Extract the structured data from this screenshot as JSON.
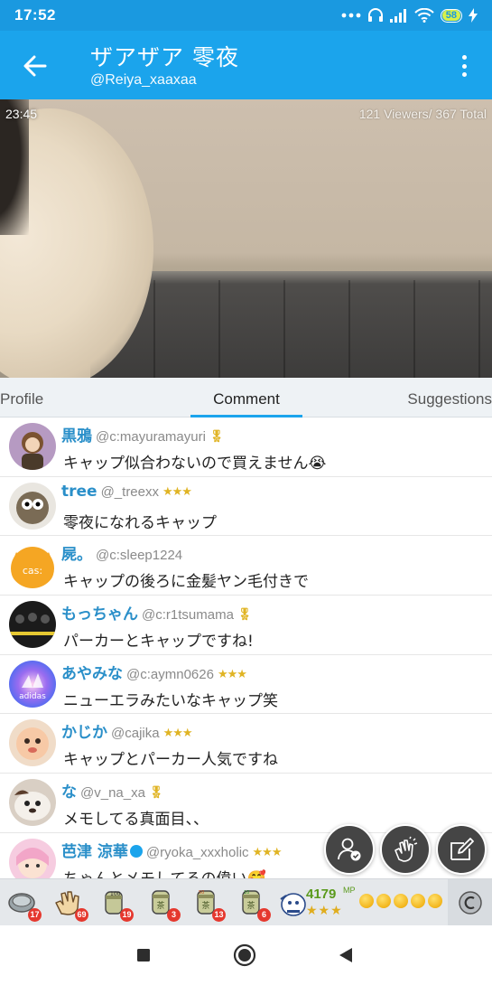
{
  "status_bar": {
    "time": "17:52",
    "battery": "58"
  },
  "header": {
    "title": "ザアザア 零夜",
    "username": "@Reiya_xaaxaa"
  },
  "video": {
    "elapsed": "23:45",
    "viewers_text": "121 Viewers/ 367 Total"
  },
  "tabs": [
    {
      "label": "Profile"
    },
    {
      "label": "Comment",
      "active": true
    },
    {
      "label": "Suggestions"
    }
  ],
  "comments": [
    {
      "name": "黒鴉",
      "handle": "@c:mayuramayuri",
      "badge": "🎖",
      "text": "キャップ似合わないので買えません😭"
    },
    {
      "name": "tree",
      "handle": "@_treexx",
      "badge": "★★★",
      "text": "零夜になれるキャップ"
    },
    {
      "name": "屍。",
      "handle": "@c:sleep1224",
      "badge": "",
      "text": "キャップの後ろに金髪ヤン毛付きで"
    },
    {
      "name": "もっちゃん",
      "handle": "@c:r1tsumama",
      "badge": "🎖",
      "text": "パーカーとキャップですね!"
    },
    {
      "name": "あやみな",
      "handle": "@c:aymn0626",
      "badge": "★★★",
      "text": "ニューエラみたいなキャップ笑"
    },
    {
      "name": "かじか",
      "handle": "@cajika",
      "badge": "★★★",
      "text": "キャップとパーカー人気ですね"
    },
    {
      "name": "な",
      "handle": "@v_na_xa",
      "badge": "🎖",
      "text": "メモしてる真面目、、"
    },
    {
      "name": "芭津 涼華",
      "handle": "@ryoka_xxxholic",
      "badge": "★★★",
      "text": "ちゃんとメモしてるの偉い🥰"
    }
  ],
  "gifts": [
    {
      "icon": "coin-gift-icon",
      "count": "17"
    },
    {
      "icon": "clap-gift-icon",
      "count": "69"
    },
    {
      "icon": "tea-100-gift-icon",
      "count": "19"
    },
    {
      "icon": "tea-gift-icon",
      "count": "3"
    },
    {
      "icon": "tea-50-gift-icon",
      "count": "13"
    },
    {
      "icon": "tea-10-gift-icon",
      "count": "6"
    }
  ],
  "mp": {
    "value": "4179",
    "unit": "MP",
    "stars": "★★★"
  },
  "colors": {
    "primary": "#1ba4ec",
    "status_bar": "#1a99e0",
    "name": "#2a8fc9",
    "badge_red": "#e5382e"
  }
}
